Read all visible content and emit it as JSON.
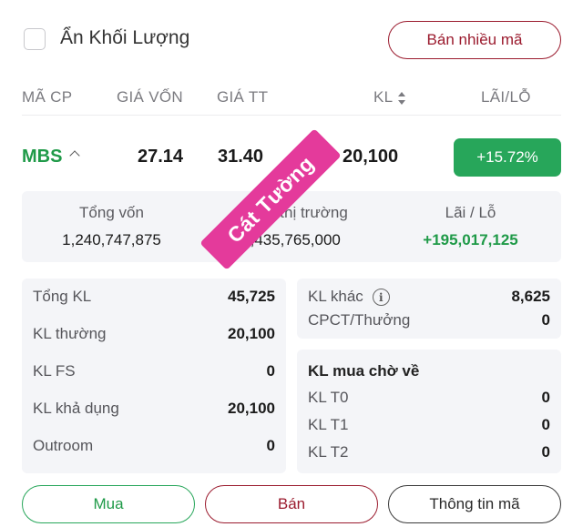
{
  "header": {
    "hide_volume_label": "Ẩn Khối Lượng",
    "sell_multi_label": "Bán nhiều mã"
  },
  "columns": {
    "code": "MÃ CP",
    "cost_price": "GIÁ VỐN",
    "market_price": "GIÁ TT",
    "volume": "KL",
    "profit_loss": "LÃI/LỖ"
  },
  "position": {
    "code": "MBS",
    "cost_price": "27.14",
    "market_price": "31.40",
    "volume": "20,100",
    "profit_loss_pct": "+15.72%"
  },
  "summary": {
    "total_capital_label": "Tổng vốn",
    "total_capital_value": "1,240,747,875",
    "market_value_label": "Giá trị thị trường",
    "market_value_value": "1,435,765,000",
    "pl_label": "Lãi / Lỗ",
    "pl_value": "+195,017,125"
  },
  "volumes": {
    "total_label": "Tổng KL",
    "total_value": "45,725",
    "normal_label": "KL thường",
    "normal_value": "20,100",
    "fs_label": "KL FS",
    "fs_value": "0",
    "available_label": "KL khả dụng",
    "available_value": "20,100",
    "outroom_label": "Outroom",
    "outroom_value": "0",
    "other_label": "KL khác",
    "other_value": "8,625",
    "dividend_label": "CPCT/Thưởng",
    "dividend_value": "0"
  },
  "pending": {
    "title": "KL mua chờ về",
    "t0_label": "KL T0",
    "t0_value": "0",
    "t1_label": "KL T1",
    "t1_value": "0",
    "t2_label": "KL T2",
    "t2_value": "0"
  },
  "actions": {
    "buy_label": "Mua",
    "sell_label": "Bán",
    "info_label": "Thông tin mã"
  },
  "watermark": {
    "text": "Cát Tường"
  },
  "colors": {
    "green": "#27a65a",
    "maroon": "#9b1b2e",
    "watermark": "#e43a9b"
  }
}
